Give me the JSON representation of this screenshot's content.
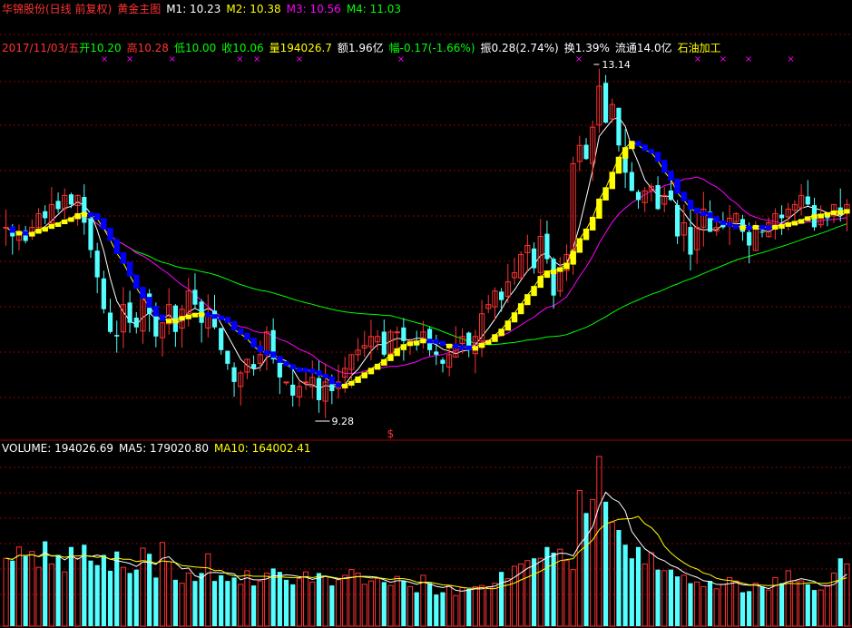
{
  "header": {
    "stock_name": "华锦股份(日线 前复权)",
    "indicator": "黄金主图",
    "m1": "M1: 10.23",
    "m2": "M2: 10.38",
    "m3": "M3: 10.56",
    "m4": "M4: 11.03"
  },
  "info": {
    "date": "2017/11/03/五",
    "open": "开10.20",
    "high": "高10.28",
    "low": "低10.00",
    "close": "收10.06",
    "vol": "量194026.7",
    "amount": "额1.96亿",
    "change": "幅-0.17(-1.66%)",
    "amplitude": "振0.28(2.74%)",
    "turnover": "换1.39%",
    "float": "流通14.0亿",
    "industry": "石油加工"
  },
  "volume_header": {
    "volume": "VOLUME: 194026.69",
    "ma5": "MA5: 179020.80",
    "ma10": "MA10: 164002.41"
  },
  "colors": {
    "up": "#ff3232",
    "down": "#54ffff",
    "m1": "#ffffff",
    "m2": "#ffff00",
    "m3": "#ff00ff",
    "m4": "#00ff00",
    "grid": "#8b0000",
    "label_red": "#ff3232",
    "label_green": "#00ff00",
    "marker": "#ff00ff"
  },
  "chart_data": {
    "type": "candlestick",
    "annotations": {
      "high_label": "13.14",
      "low_label": "9.28",
      "s_marker": "$",
      "cross": "×"
    },
    "y_ref": {
      "p1": 13.14,
      "p2": 9.28
    },
    "closes": [
      11.35,
      11.25,
      11.3,
      11.2,
      11.35,
      11.5,
      11.45,
      11.6,
      11.55,
      11.7,
      11.6,
      11.7,
      11.4,
      11.1,
      10.8,
      10.45,
      10.2,
      10.15,
      10.5,
      10.3,
      10.25,
      10.6,
      10.4,
      10.15,
      10.3,
      10.5,
      10.2,
      10.45,
      10.65,
      10.5,
      10.3,
      10.4,
      10.25,
      10.0,
      9.85,
      9.65,
      9.75,
      9.9,
      9.8,
      9.95,
      10.2,
      9.9,
      9.7,
      9.65,
      9.5,
      9.6,
      9.65,
      9.7,
      9.45,
      9.65,
      9.55,
      9.65,
      9.8,
      9.95,
      10.0,
      10.05,
      10.15,
      10.15,
      9.95,
      10.2,
      10.2,
      10.1,
      10.1,
      10.05,
      10.2,
      10.0,
      9.95,
      9.85,
      9.95,
      10.05,
      10.15,
      10.0,
      10.15,
      10.4,
      10.5,
      10.65,
      10.55,
      10.75,
      10.85,
      11.05,
      11.15,
      10.9,
      11.25,
      11.0,
      10.6,
      10.9,
      11.05,
      12.05,
      12.25,
      12.1,
      12.45,
      12.9,
      12.5,
      12.7,
      12.25,
      11.95,
      11.75,
      11.65,
      11.75,
      11.8,
      11.55,
      11.7,
      11.65,
      11.25,
      11.4,
      11.05,
      11.35,
      11.55,
      11.3,
      11.35,
      11.35,
      11.45,
      11.5,
      11.3,
      11.15,
      11.35,
      11.3,
      11.4,
      11.5,
      11.45,
      11.55,
      11.6,
      11.7,
      11.6,
      11.35,
      11.45,
      11.45,
      11.6,
      11.5,
      11.6
    ],
    "volumes": [
      60,
      58,
      70,
      62,
      66,
      52,
      75,
      55,
      63,
      48,
      70,
      60,
      72,
      58,
      54,
      63,
      49,
      66,
      52,
      47,
      50,
      69,
      64,
      43,
      74,
      57,
      41,
      38,
      47,
      40,
      47,
      64,
      40,
      45,
      40,
      43,
      37,
      49,
      36,
      40,
      47,
      51,
      48,
      41,
      37,
      42,
      48,
      39,
      47,
      44,
      36,
      41,
      45,
      50,
      47,
      37,
      40,
      42,
      39,
      36,
      44,
      40,
      35,
      30,
      45,
      38,
      28,
      30,
      36,
      27,
      34,
      33,
      35,
      36,
      35,
      38,
      48,
      42,
      53,
      55,
      58,
      60,
      60,
      70,
      65,
      68,
      58,
      50,
      120,
      100,
      112,
      150,
      110,
      92,
      85,
      72,
      60,
      70,
      55,
      65,
      50,
      49,
      50,
      44,
      45,
      38,
      39,
      35,
      40,
      33,
      37,
      43,
      40,
      30,
      31,
      38,
      35,
      32,
      43,
      38,
      49,
      40,
      40,
      37,
      32,
      32,
      36,
      47,
      60,
      55
    ]
  }
}
